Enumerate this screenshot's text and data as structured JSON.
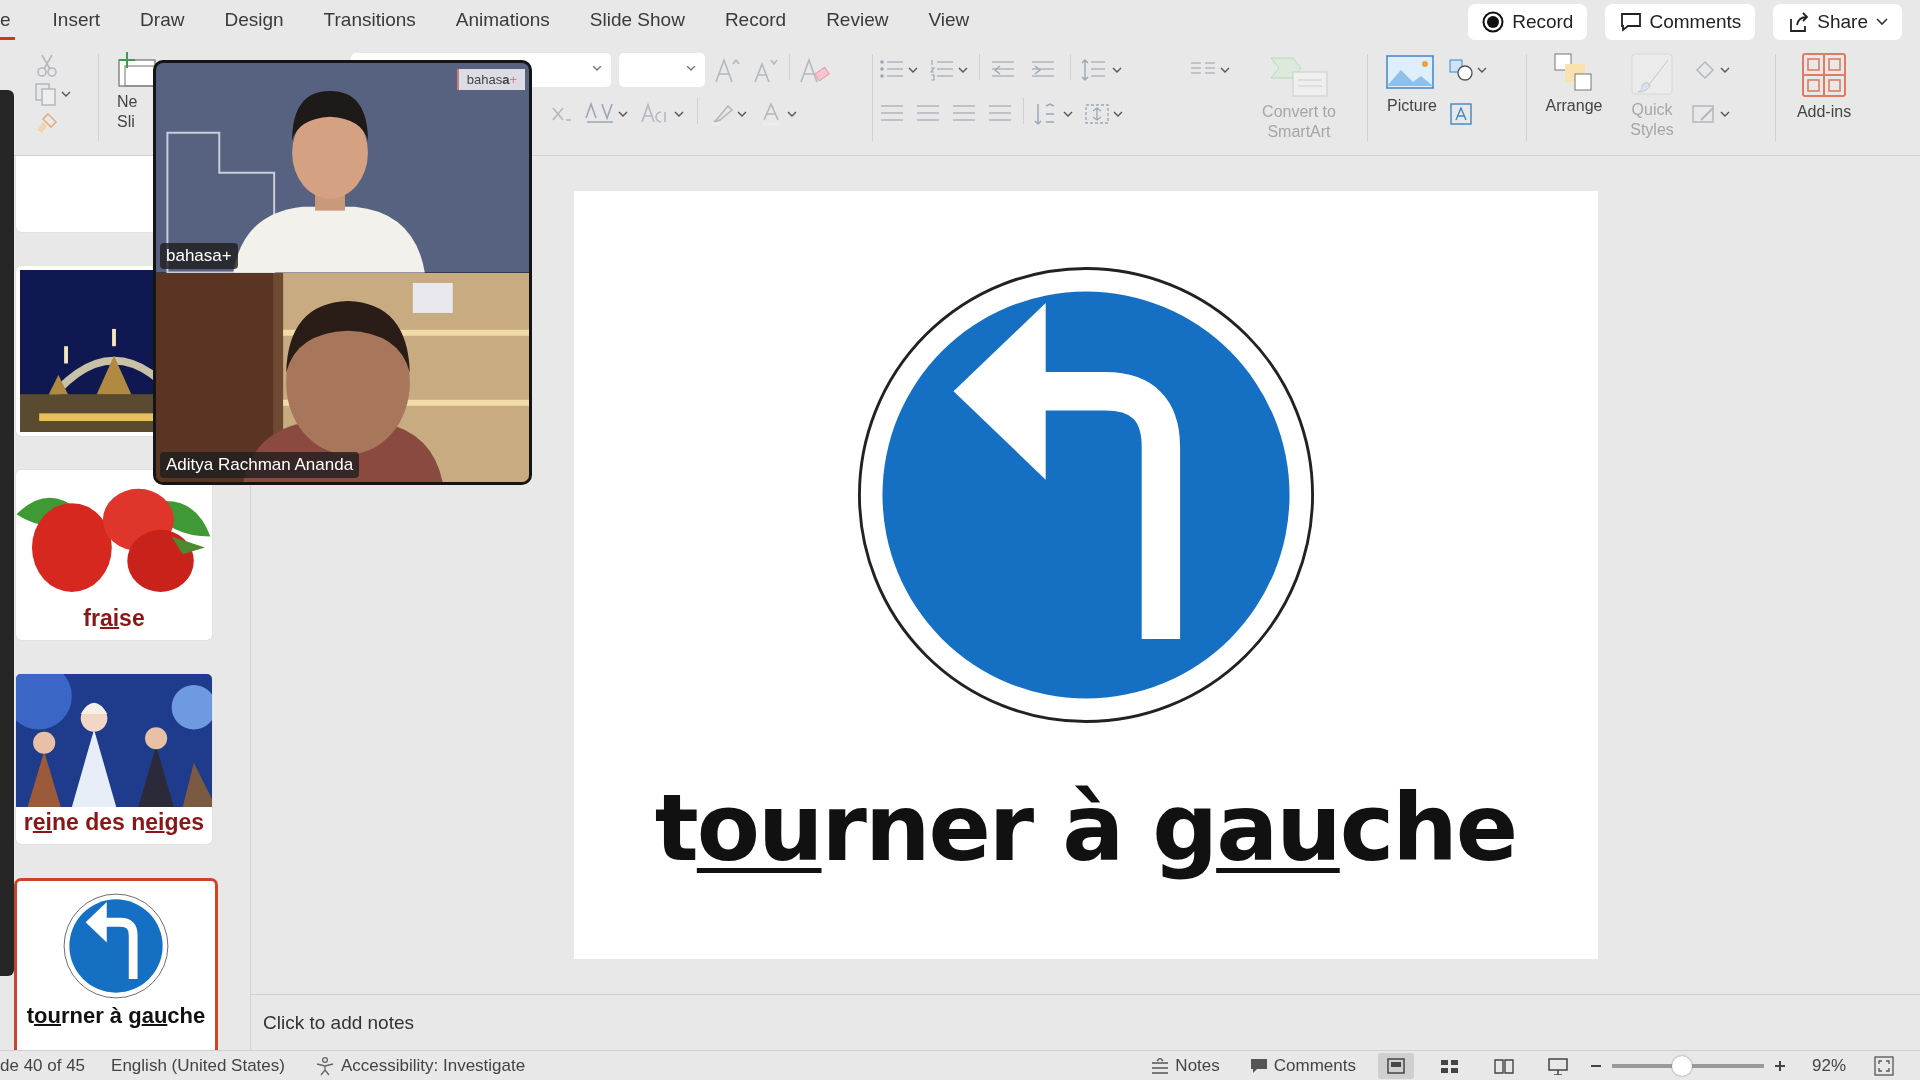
{
  "menu_tabs": [
    {
      "label": "e",
      "selected": true
    },
    {
      "label": "Insert",
      "selected": false
    },
    {
      "label": "Draw",
      "selected": false
    },
    {
      "label": "Design",
      "selected": false
    },
    {
      "label": "Transitions",
      "selected": false
    },
    {
      "label": "Animations",
      "selected": false
    },
    {
      "label": "Slide Show",
      "selected": false
    },
    {
      "label": "Record",
      "selected": false
    },
    {
      "label": "Review",
      "selected": false
    },
    {
      "label": "View",
      "selected": false
    }
  ],
  "header_buttons": [
    {
      "kind": "record",
      "label": "Record"
    },
    {
      "kind": "comments",
      "label": "Comments"
    },
    {
      "kind": "share",
      "label": "Share"
    }
  ],
  "ribbon": {
    "new_slide": {
      "label": [
        "Ne",
        "Sli"
      ]
    },
    "big_buttons": [
      {
        "kind": "smartart",
        "label": [
          "Convert to",
          "SmartArt"
        ],
        "disabled": true
      },
      {
        "kind": "picture",
        "label": [
          "Picture"
        ],
        "disabled": false
      },
      {
        "kind": "arrange",
        "label": [
          "Arrange"
        ],
        "disabled": false
      },
      {
        "kind": "quick-styles",
        "label": [
          "Quick",
          "Styles"
        ],
        "disabled": true
      },
      {
        "kind": "add-ins",
        "label": [
          "Add-ins"
        ],
        "disabled": false
      }
    ]
  },
  "slides": [
    {
      "kind": "blank",
      "selected": false
    },
    {
      "kind": "picture",
      "selected": false
    },
    {
      "kind": "picture",
      "selected": false,
      "caption": [
        {
          "text": "fr",
          "underline": false
        },
        {
          "text": "ai",
          "underline": true
        },
        {
          "text": "se",
          "underline": false
        }
      ]
    },
    {
      "kind": "picture",
      "selected": false,
      "caption": [
        {
          "text": "r",
          "underline": false
        },
        {
          "text": "ei",
          "underline": true
        },
        {
          "text": "ne des n",
          "underline": false
        },
        {
          "text": "ei",
          "underline": true
        },
        {
          "text": "ges",
          "underline": false
        }
      ]
    },
    {
      "kind": "sign",
      "selected": true,
      "caption": [
        {
          "text": "t",
          "underline": false
        },
        {
          "text": "ou",
          "underline": true
        },
        {
          "text": "rner à g",
          "underline": false
        },
        {
          "text": "au",
          "underline": true
        },
        {
          "text": "che",
          "underline": false
        }
      ]
    }
  ],
  "slide": {
    "kind": "sign",
    "title": [
      {
        "text": "t",
        "underline": false
      },
      {
        "text": "ou",
        "underline": true
      },
      {
        "text": "rner à g",
        "underline": false
      },
      {
        "text": "au",
        "underline": true
      },
      {
        "text": "che",
        "underline": false
      }
    ]
  },
  "notes": {
    "placeholder": "Click to add notes"
  },
  "video_call": {
    "tiles": [
      {
        "name": "bahasa+",
        "logo": "bahas**a**",
        "logo_mark": "+"
      },
      {
        "name": "Aditya Rachman Ananda"
      }
    ]
  },
  "status_bar": {
    "slide_position": "de 40 of 45",
    "language": "English (United States)",
    "accessibility": "Accessibility: Investigate",
    "notes": "Notes",
    "comments": "Comments",
    "views": [
      {
        "kind": "normal",
        "selected": true
      },
      {
        "kind": "sorter",
        "selected": false
      },
      {
        "kind": "reading",
        "selected": false
      },
      {
        "kind": "slideshow",
        "selected": false
      }
    ],
    "zoom": {
      "level": 0.46,
      "reading": "92%"
    }
  }
}
